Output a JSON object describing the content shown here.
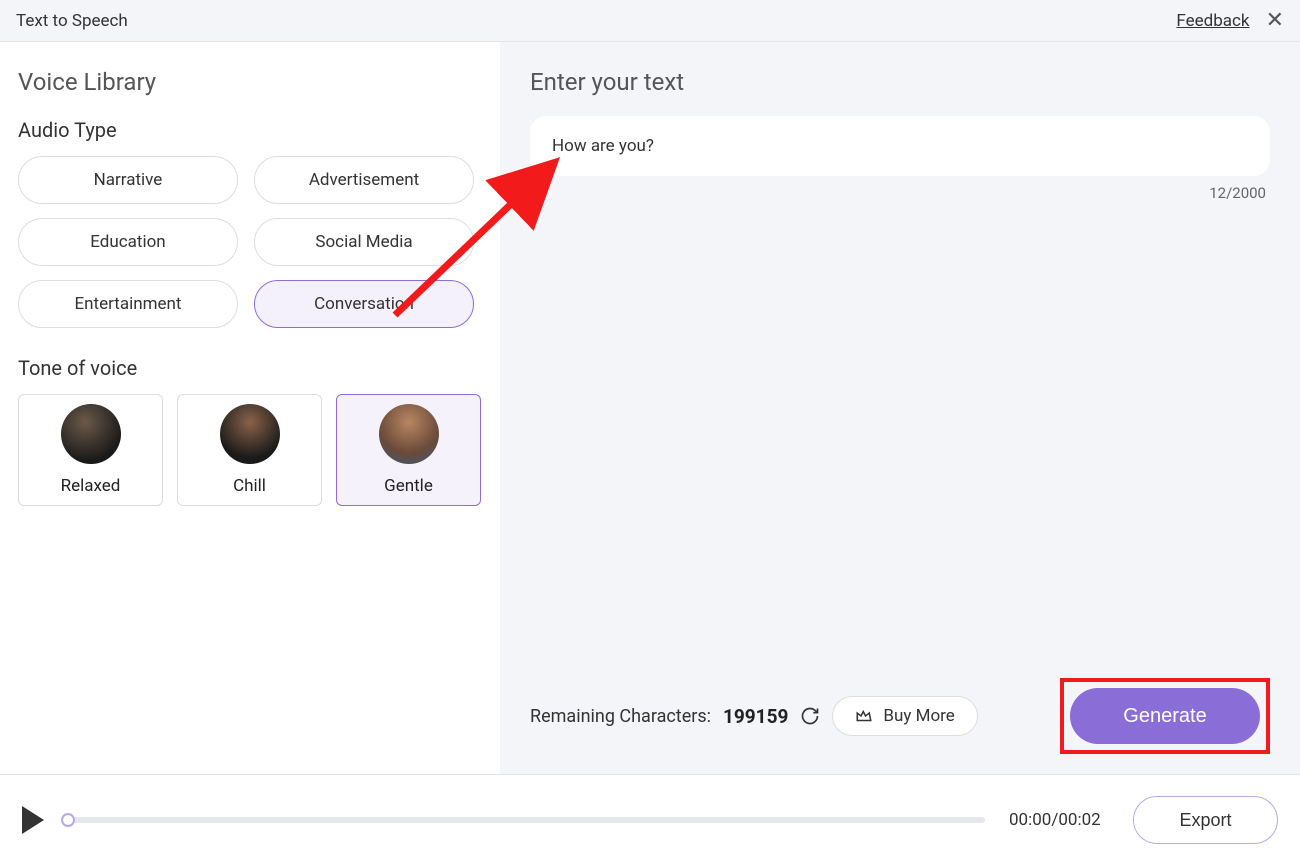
{
  "header": {
    "title": "Text to Speech",
    "feedback": "Feedback"
  },
  "left": {
    "voice_library_title": "Voice Library",
    "audio_type_title": "Audio Type",
    "audio_types": {
      "narrative": "Narrative",
      "advertisement": "Advertisement",
      "education": "Education",
      "social_media": "Social Media",
      "entertainment": "Entertainment",
      "conversation": "Conversation"
    },
    "tone_title": "Tone of voice",
    "tones": {
      "relaxed": "Relaxed",
      "chill": "Chill",
      "gentle": "Gentle"
    }
  },
  "right": {
    "enter_text_title": "Enter your text",
    "text_content": "How are you?",
    "char_count": "12/2000",
    "remaining_label": "Remaining Characters:",
    "remaining_count": "199159",
    "buy_more": "Buy More",
    "generate": "Generate"
  },
  "player": {
    "time": "00:00/00:02",
    "export": "Export"
  }
}
